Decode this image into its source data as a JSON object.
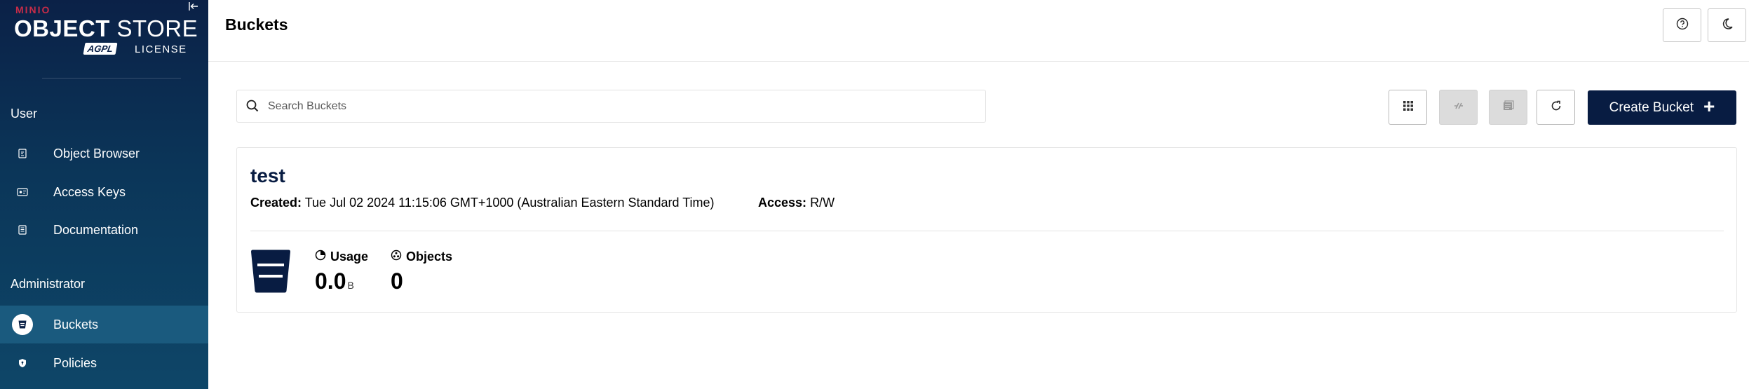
{
  "sidebar": {
    "logo": {
      "brand": "MINIO",
      "product_bold": "OBJECT",
      "product_rest": "STORE",
      "badge": "AGPL",
      "license": "LICENSE"
    },
    "sections": [
      {
        "title": "User",
        "items": [
          {
            "label": "Object Browser",
            "icon": "object-browser-icon"
          },
          {
            "label": "Access Keys",
            "icon": "access-keys-icon"
          },
          {
            "label": "Documentation",
            "icon": "documentation-icon"
          }
        ]
      },
      {
        "title": "Administrator",
        "items": [
          {
            "label": "Buckets",
            "icon": "bucket-icon",
            "active": true
          },
          {
            "label": "Policies",
            "icon": "policy-icon"
          }
        ]
      }
    ]
  },
  "header": {
    "title": "Buckets",
    "buttons": [
      "help-icon",
      "dark-mode-icon"
    ]
  },
  "toolbar": {
    "search_placeholder": "Search Buckets",
    "search_value": "",
    "create_label": "Create Bucket",
    "create_symbol": "+",
    "tools": [
      "select-multiple-icon",
      "replication-icon",
      "lifecycle-icon",
      "refresh-icon"
    ]
  },
  "buckets": [
    {
      "name": "test",
      "created_label": "Created:",
      "created_value": "Tue Jul 02 2024 11:15:06 GMT+1000 (Australian Eastern Standard Time)",
      "access_label": "Access:",
      "access_value": "R/W",
      "usage_label": "Usage",
      "usage_value": "0.0",
      "usage_unit": "B",
      "objects_label": "Objects",
      "objects_value": "0"
    }
  ],
  "colors": {
    "accent": "#081c42",
    "brand_red": "#c72c48",
    "active_nav": "#1a5a7e"
  }
}
